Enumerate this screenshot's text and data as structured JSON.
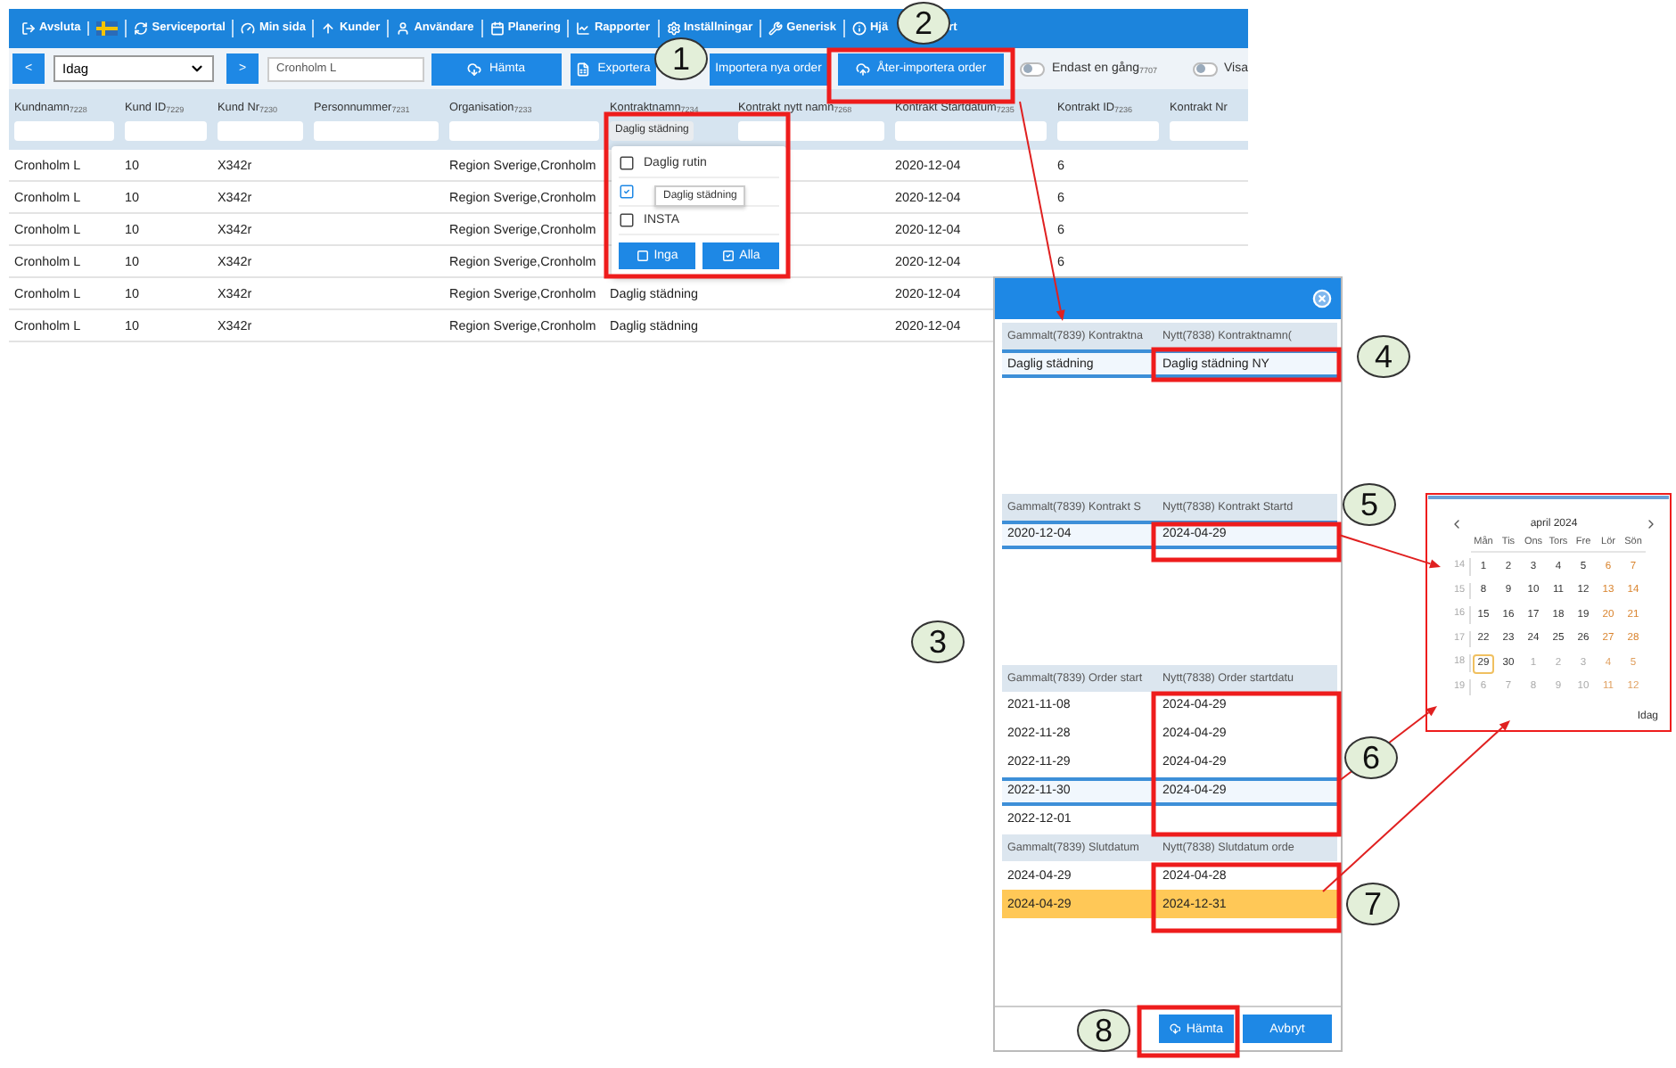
{
  "app": {
    "menu": [
      {
        "kind": "link",
        "label": "Avsluta"
      },
      {
        "kind": "flag"
      },
      {
        "kind": "link",
        "label": "Serviceportal"
      },
      {
        "kind": "link",
        "label": "Min sida"
      },
      {
        "kind": "link",
        "label": "Kunder"
      },
      {
        "kind": "link",
        "label": "Användare"
      },
      {
        "kind": "link",
        "label": "Planering"
      },
      {
        "kind": "link",
        "label": "Rapporter"
      },
      {
        "kind": "link",
        "label": "Inställningar"
      },
      {
        "kind": "link",
        "label": "Generisk"
      },
      {
        "kind": "link",
        "label": "Hjä",
        "tail": "rt"
      }
    ],
    "controls": {
      "prev": "<",
      "date_select": "Idag",
      "next": ">",
      "search_value": "Cronholm L",
      "buttons": [
        {
          "label": "Hämta"
        },
        {
          "label": "Exportera"
        },
        {
          "label": "Importera nya order"
        },
        {
          "label": "Åter-importera order"
        }
      ],
      "toggles": [
        {
          "label": "Endast en gång$_{7707}$",
          "on": false
        },
        {
          "label": "Visa",
          "on": false
        }
      ]
    },
    "table": {
      "columns": [
        {
          "label": "Kundnamn$_{7228}$"
        },
        {
          "label": "Kund ID$_{7229}$"
        },
        {
          "label": "Kund Nr$_{7230}$"
        },
        {
          "label": "Personnummer$_{7231}$"
        },
        {
          "label": "Organisation$_{7233}$"
        },
        {
          "label": "Kontraktnamn$_{7234}$",
          "filter": "Daglig städning"
        },
        {
          "label": "Kontrakt nytt namn$_{7268}$"
        },
        {
          "label": "Kontrakt Startdatum$_{7235}$"
        },
        {
          "label": "Kontrakt ID$_{7236}$"
        },
        {
          "label": "Kontrakt Nr"
        }
      ],
      "rows": [
        {
          "cells": [
            "Cronholm L",
            "10",
            "X342r",
            null,
            "Region Sverige,Cronholm",
            null,
            null,
            "2020-12-04",
            "6",
            null
          ]
        },
        {
          "cells": [
            "Cronholm L",
            "10",
            "X342r",
            null,
            "Region Sverige,Cronholm",
            null,
            null,
            "2020-12-04",
            "6",
            null
          ]
        },
        {
          "cells": [
            "Cronholm L",
            "10",
            "X342r",
            null,
            "Region Sverige,Cronholm",
            null,
            null,
            "2020-12-04",
            "6",
            null
          ]
        },
        {
          "cells": [
            "Cronholm L",
            "10",
            "X342r",
            null,
            "Region Sverige,Cronholm",
            null,
            null,
            "2020-12-04",
            "6",
            null
          ]
        },
        {
          "cells": [
            "Cronholm L",
            "10",
            "X342r",
            null,
            "Region Sverige,Cronholm",
            "Daglig städning",
            null,
            "2020-12-04",
            null,
            null
          ]
        },
        {
          "cells": [
            "Cronholm L",
            "10",
            "X342r",
            null,
            "Region Sverige,Cronholm",
            "Daglig städning",
            null,
            "2020-12-04",
            null,
            null
          ]
        }
      ]
    },
    "filter_popup": {
      "options": [
        {
          "label": "Daglig rutin",
          "checked": false
        },
        {
          "checked": true
        },
        {
          "label": "INSTA",
          "checked": false
        }
      ],
      "tooltip": "Daglig städning",
      "buttons": [
        {
          "label": "Inga",
          "kind": "none"
        },
        {
          "label": "Alla",
          "kind": "all"
        }
      ]
    }
  },
  "dialog": {
    "groups": [
      {
        "old_header": "Gammalt(7839) Kontraktna",
        "new_header": "Nytt(7838) Kontraktnamn(",
        "rows": [
          {
            "old": "Daglig städning",
            "new": "Daglig städning NY",
            "selected": true,
            "warning": false
          }
        ]
      },
      {
        "old_header": "Gammalt(7839) Kontrakt S",
        "new_header": "Nytt(7838) Kontrakt Startd",
        "rows": [
          {
            "old": "2020-12-04",
            "new": "2024-04-29",
            "selected": true,
            "warning": false
          }
        ]
      },
      {
        "old_header": "Gammalt(7839) Order start",
        "new_header": "Nytt(7838) Order startdatu",
        "rows": [
          {
            "old": "2021-11-08",
            "new": "2024-04-29",
            "selected": false,
            "warning": false
          },
          {
            "old": "2022-11-28",
            "new": "2024-04-29",
            "selected": false,
            "warning": false
          },
          {
            "old": "2022-11-29",
            "new": "2024-04-29",
            "selected": false,
            "warning": false
          },
          {
            "old": "2022-11-30",
            "new": "2024-04-29",
            "selected": true,
            "warning": false
          },
          {
            "old": "2022-12-01",
            "selected": false,
            "warning": false
          }
        ]
      },
      {
        "old_header": "Gammalt(7839) Slutdatum",
        "new_header": "Nytt(7838) Slutdatum orde",
        "rows": [
          {
            "old": "2024-04-29",
            "new": "2024-04-28",
            "selected": false,
            "warning": false
          },
          {
            "old": "2024-04-29",
            "new": "2024-12-31",
            "selected": false,
            "warning": true
          }
        ]
      }
    ],
    "buttons": [
      {
        "label": "Hämta",
        "kind": "fetch"
      },
      {
        "label": "Avbryt",
        "kind": "cancel"
      }
    ]
  },
  "calendar": {
    "month": "april 2024",
    "weekdays": [
      "Mån",
      "Tis",
      "Ons",
      "Tors",
      "Fre",
      "Lör",
      "Sön"
    ],
    "weeks": [
      {
        "number": "14",
        "days": [
          {
            "day": "1",
            "outside": false,
            "selected": false
          },
          {
            "day": "2",
            "outside": false,
            "selected": false
          },
          {
            "day": "3",
            "outside": false,
            "selected": false
          },
          {
            "day": "4",
            "outside": false,
            "selected": false
          },
          {
            "day": "5",
            "outside": false,
            "selected": false
          },
          {
            "day": "6",
            "outside": false,
            "selected": false
          },
          {
            "day": "7",
            "outside": false,
            "selected": false
          }
        ]
      },
      {
        "number": "15",
        "days": [
          {
            "day": "8",
            "outside": false,
            "selected": false
          },
          {
            "day": "9",
            "outside": false,
            "selected": false
          },
          {
            "day": "10",
            "outside": false,
            "selected": false
          },
          {
            "day": "11",
            "outside": false,
            "selected": false
          },
          {
            "day": "12",
            "outside": false,
            "selected": false
          },
          {
            "day": "13",
            "outside": false,
            "selected": false
          },
          {
            "day": "14",
            "outside": false,
            "selected": false
          }
        ]
      },
      {
        "number": "16",
        "days": [
          {
            "day": "15",
            "outside": false,
            "selected": false
          },
          {
            "day": "16",
            "outside": false,
            "selected": false
          },
          {
            "day": "17",
            "outside": false,
            "selected": false
          },
          {
            "day": "18",
            "outside": false,
            "selected": false
          },
          {
            "day": "19",
            "outside": false,
            "selected": false
          },
          {
            "day": "20",
            "outside": false,
            "selected": false
          },
          {
            "day": "21",
            "outside": false,
            "selected": false
          }
        ]
      },
      {
        "number": "17",
        "days": [
          {
            "day": "22",
            "outside": false,
            "selected": false
          },
          {
            "day": "23",
            "outside": false,
            "selected": false
          },
          {
            "day": "24",
            "outside": false,
            "selected": false
          },
          {
            "day": "25",
            "outside": false,
            "selected": false
          },
          {
            "day": "26",
            "outside": false,
            "selected": false
          },
          {
            "day": "27",
            "outside": false,
            "selected": false
          },
          {
            "day": "28",
            "outside": false,
            "selected": false
          }
        ]
      },
      {
        "number": "18",
        "days": [
          {
            "day": "29",
            "outside": false,
            "selected": true
          },
          {
            "day": "30",
            "outside": false,
            "selected": false
          },
          {
            "day": "1",
            "outside": true,
            "selected": false
          },
          {
            "day": "2",
            "outside": true,
            "selected": false
          },
          {
            "day": "3",
            "outside": true,
            "selected": false
          },
          {
            "day": "4",
            "outside": true,
            "selected": false
          },
          {
            "day": "5",
            "outside": true,
            "selected": false
          }
        ]
      },
      {
        "number": "19",
        "days": [
          {
            "day": "6",
            "outside": true,
            "selected": false
          },
          {
            "day": "7",
            "outside": true,
            "selected": false
          },
          {
            "day": "8",
            "outside": true,
            "selected": false
          },
          {
            "day": "9",
            "outside": true,
            "selected": false
          },
          {
            "day": "10",
            "outside": true,
            "selected": false
          },
          {
            "day": "11",
            "outside": true,
            "selected": false
          },
          {
            "day": "12",
            "outside": true,
            "selected": false
          }
        ]
      }
    ],
    "today_link": "Idag"
  },
  "callouts": [
    "1",
    "2",
    "3",
    "4",
    "5",
    "6",
    "7",
    "8"
  ]
}
